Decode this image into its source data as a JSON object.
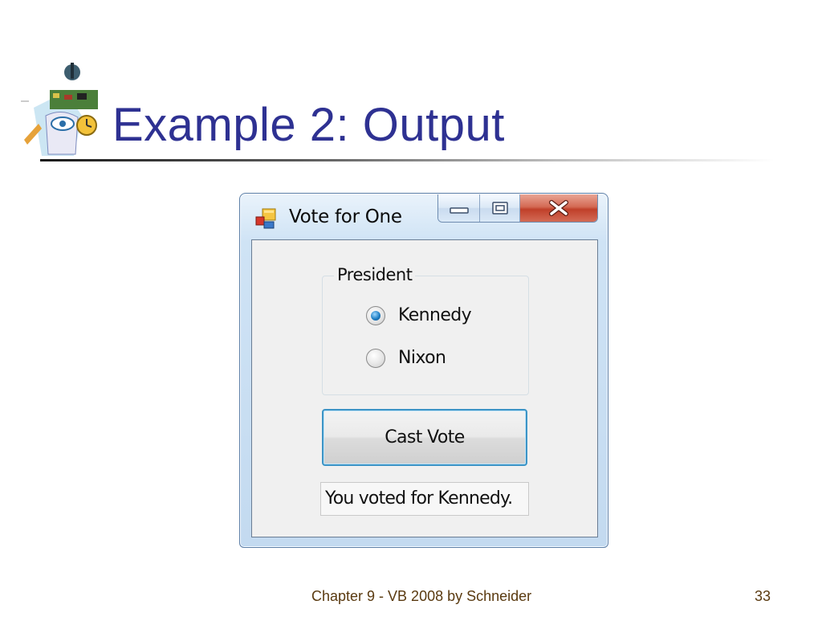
{
  "slide": {
    "title": "Example 2: Output",
    "footer": "Chapter 9 - VB 2008 by Schneider",
    "page_number": "33"
  },
  "logo": {
    "icon": "clipart-logo-icon"
  },
  "window": {
    "title": "Vote for One",
    "icon": "form-app-icon",
    "controls": [
      "minimize-icon",
      "maximize-icon",
      "close-icon"
    ]
  },
  "group": {
    "legend": "President",
    "options": [
      {
        "label": "Kennedy",
        "selected": true
      },
      {
        "label": "Nixon",
        "selected": false
      }
    ]
  },
  "button": {
    "label": "Cast Vote"
  },
  "output": {
    "text": "You voted for Kennedy."
  },
  "colors": {
    "title": "#2e3192",
    "footer": "#5a3a10",
    "button_border": "#3c94c6",
    "close_button": "#c0402a"
  }
}
